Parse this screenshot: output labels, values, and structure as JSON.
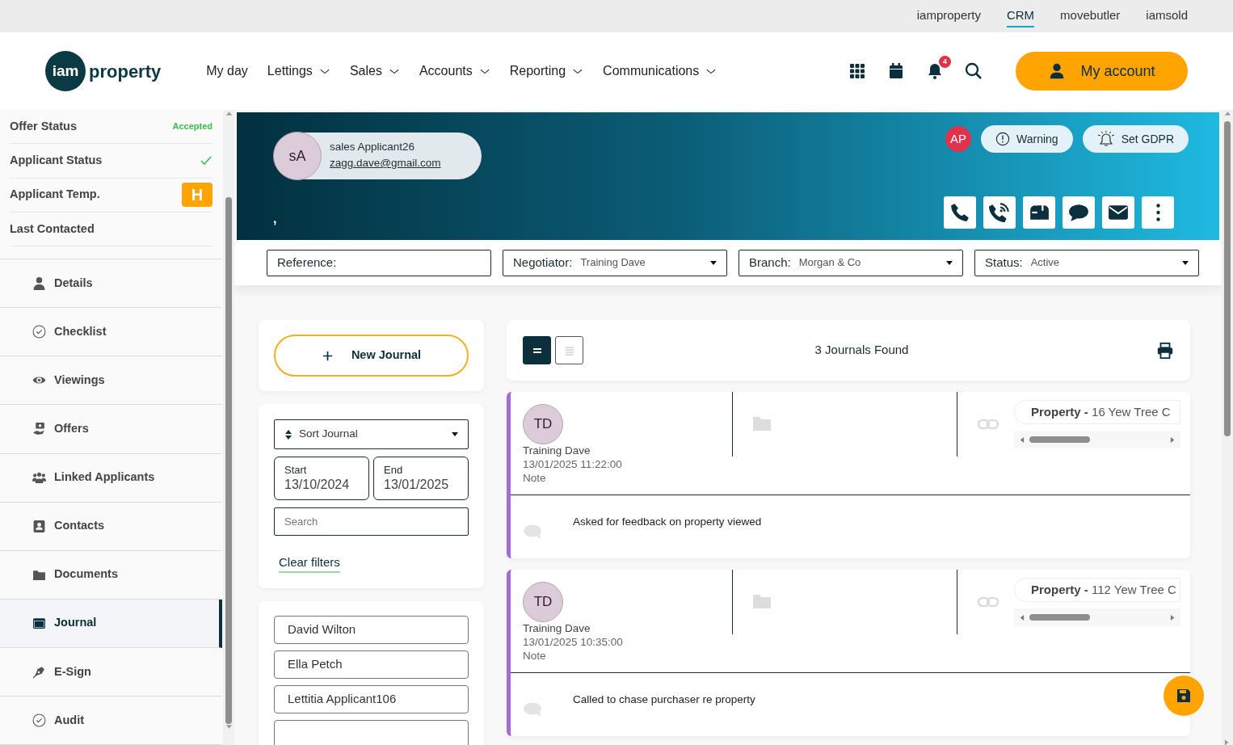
{
  "top_links": [
    {
      "label": "iamproperty",
      "selected": false
    },
    {
      "label": "CRM",
      "selected": true
    },
    {
      "label": "movebutler",
      "selected": false
    },
    {
      "label": "iamsold",
      "selected": false
    }
  ],
  "header": {
    "logo_mark": "iam",
    "logo_word": "property",
    "nav": [
      {
        "label": "My day",
        "dropdown": false
      },
      {
        "label": "Lettings",
        "dropdown": true
      },
      {
        "label": "Sales",
        "dropdown": true
      },
      {
        "label": "Accounts",
        "dropdown": true
      },
      {
        "label": "Reporting",
        "dropdown": true
      },
      {
        "label": "Communications",
        "dropdown": true
      }
    ],
    "notification_count": "4",
    "account_button": "My account"
  },
  "sidebar": {
    "summary": [
      {
        "label": "Offer Status",
        "kind": "text",
        "value": "Accepted"
      },
      {
        "label": "Applicant Status",
        "kind": "check"
      },
      {
        "label": "Applicant Temp.",
        "kind": "badge",
        "value": "H"
      },
      {
        "label": "Last Contacted",
        "kind": "empty"
      }
    ],
    "items": [
      {
        "label": "Details",
        "selected": false
      },
      {
        "label": "Checklist",
        "selected": false
      },
      {
        "label": "Viewings",
        "selected": false
      },
      {
        "label": "Offers",
        "selected": false
      },
      {
        "label": "Linked Applicants",
        "selected": false
      },
      {
        "label": "Contacts",
        "selected": false
      },
      {
        "label": "Documents",
        "selected": false
      },
      {
        "label": "Journal",
        "selected": true
      },
      {
        "label": "E-Sign",
        "selected": false
      },
      {
        "label": "Audit",
        "selected": false
      }
    ]
  },
  "profile": {
    "initials": "sA",
    "name": "sales Applicant26",
    "email": "zagg.dave@gmail.com",
    "subtitle": ",",
    "user_badge": "AP",
    "pills": [
      "Warning",
      "Set GDPR"
    ]
  },
  "filters": [
    {
      "label": "Reference:",
      "dropdown": false
    },
    {
      "label": "Negotiator:",
      "value": "Training Dave",
      "dropdown": true
    },
    {
      "label": "Branch:",
      "value": "Morgan & Co",
      "dropdown": true
    },
    {
      "label": "Status:",
      "value": "Active",
      "dropdown": true
    }
  ],
  "journal_panel": {
    "new_button": "New Journal",
    "sort": "Sort Journal",
    "start": {
      "label": "Start",
      "value": "13/10/2024"
    },
    "end": {
      "label": "End",
      "value": "13/01/2025"
    },
    "search": {
      "placeholder": "Search"
    },
    "clear_filters": "Clear filters",
    "people": [
      "David Wilton",
      "Ella Petch",
      "Lettitia Applicant106"
    ]
  },
  "view_toggle": [
    {
      "selected": true
    },
    {
      "selected": false
    }
  ],
  "journals_found": "3 Journals Found",
  "journals": [
    {
      "initials": "TD",
      "author": "Training Dave",
      "datetime": "13/01/2025 11:22:00",
      "type": "Note",
      "property": "**Property -** 16 Yew Tree C",
      "note": "Asked for feedback on property viewed"
    },
    {
      "initials": "TD",
      "author": "Training Dave",
      "datetime": "13/01/2025 10:35:00",
      "type": "Note",
      "property": "**Property -** 112 Yew Tree C",
      "note": "Called to chase purchaser re property"
    }
  ]
}
